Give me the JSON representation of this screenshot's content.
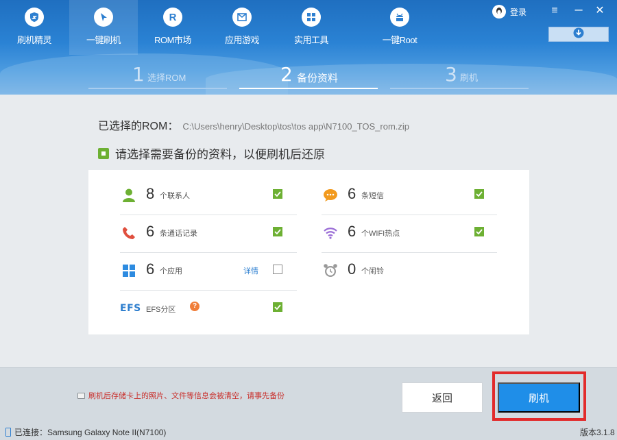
{
  "nav": {
    "tabs": [
      {
        "label": "刷机精灵",
        "icon": "shield-icon"
      },
      {
        "label": "一键刷机",
        "icon": "pointer-icon"
      },
      {
        "label": "ROM市场",
        "icon": "rom-r-icon"
      },
      {
        "label": "应用游戏",
        "icon": "mail-icon"
      },
      {
        "label": "实用工具",
        "icon": "grid-icon"
      },
      {
        "label": "一键Root",
        "icon": "android-icon"
      }
    ],
    "active_tab": "一键刷机",
    "login_label": "登录"
  },
  "steps": [
    {
      "num": "1",
      "label": "选择ROM"
    },
    {
      "num": "2",
      "label": "备份资料"
    },
    {
      "num": "3",
      "label": "刷机"
    }
  ],
  "rom": {
    "label": "已选择的ROM：",
    "path": "C:\\Users\\henry\\Desktop\\tos\\tos app\\N7100_TOS_rom.zip"
  },
  "backup": {
    "prompt": "请选择需要备份的资料，以便刷机后还原",
    "items": [
      {
        "count": "8",
        "label": "个联系人",
        "checked": true,
        "icon": "contact-icon"
      },
      {
        "count": "6",
        "label": "条短信",
        "checked": true,
        "icon": "sms-icon"
      },
      {
        "count": "6",
        "label": "条通话记录",
        "checked": true,
        "icon": "phone-icon"
      },
      {
        "count": "6",
        "label": "个WIFI热点",
        "checked": true,
        "icon": "wifi-icon"
      },
      {
        "count": "6",
        "label": "个应用",
        "checked": false,
        "icon": "apps-icon",
        "detail": "详情"
      },
      {
        "count": "0",
        "label": "个闹铃",
        "checked": false,
        "icon": "alarm-icon"
      },
      {
        "count": "",
        "label": "EFS分区",
        "checked": true,
        "icon": "efs-icon",
        "badge": "EFS",
        "help": "?"
      }
    ]
  },
  "footer": {
    "warning": "刷机后存储卡上的照片、文件等信息会被清空，请事先备份",
    "back_label": "返回",
    "flash_label": "刷机",
    "status": "已连接：Samsung Galaxy Note II(N7100)",
    "version": "版本3.1.8"
  },
  "colors": {
    "accent": "#1f8ee8",
    "check_green": "#6db033",
    "highlight_red": "#e22b2b",
    "warning_red": "#c9302c"
  }
}
